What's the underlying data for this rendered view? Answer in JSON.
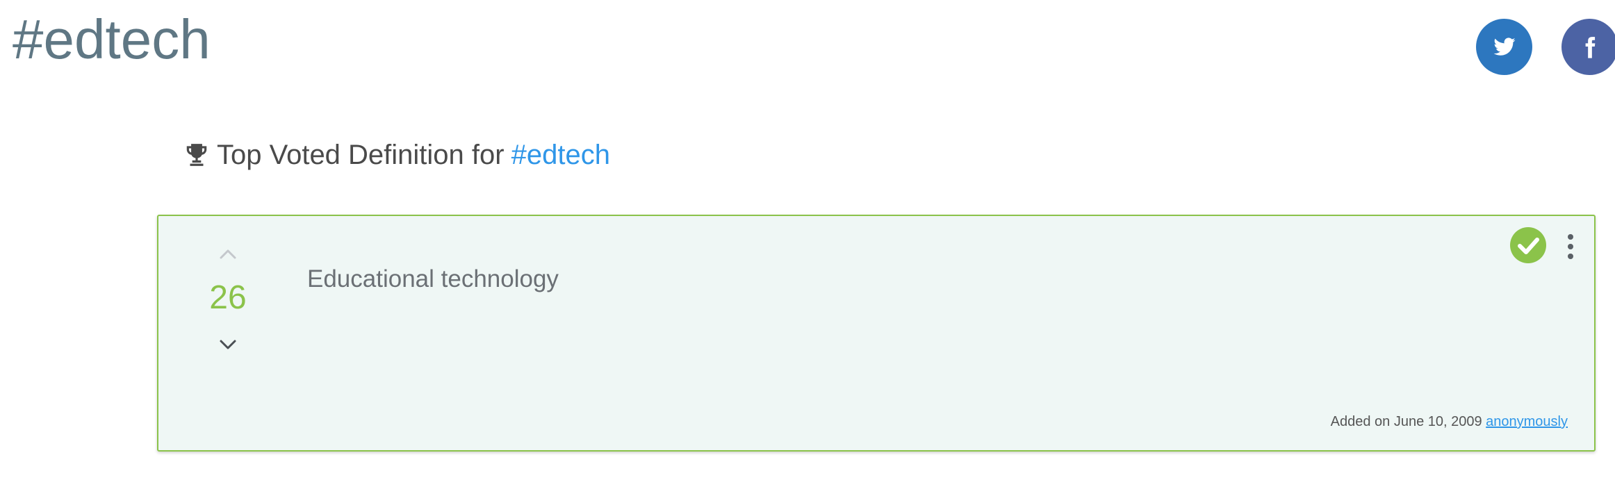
{
  "hashtag": "#edtech",
  "social": {
    "twitter_icon": "twitter-icon",
    "facebook_icon": "facebook-icon",
    "twitter_color": "#2d77bf",
    "facebook_color": "#4c63a4"
  },
  "top_voted": {
    "prefix": "Top Voted Definition for",
    "hashtag_link": "#edtech",
    "icon": "trophy-icon"
  },
  "definition_card": {
    "votes": "26",
    "text": "Educational technology",
    "added_prefix": "Added on June 10, 2009",
    "author_link": "anonymously",
    "status_icon": "check-circle-icon",
    "accent_color": "#8bc34a",
    "background_color": "#eff7f5"
  }
}
